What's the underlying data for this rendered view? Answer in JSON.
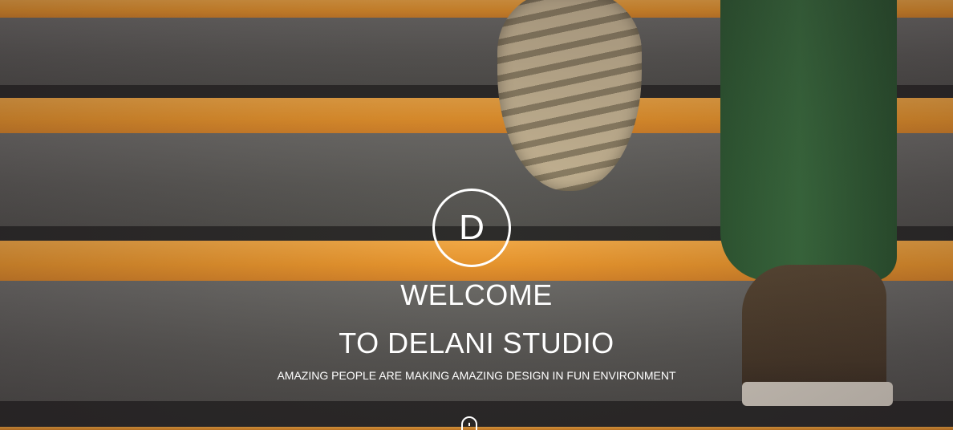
{
  "hero": {
    "logo_letter": "D",
    "title_line1": "WELCOME",
    "title_line2": "TO DELANI STUDIO",
    "tagline": "AMAZING PEOPLE ARE MAKING AMAZING DESIGN IN FUN ENVIRONMENT",
    "scroll_icon": "mouse-scroll-icon"
  },
  "colors": {
    "stripe": "#e9962d",
    "text": "#ffffff"
  }
}
